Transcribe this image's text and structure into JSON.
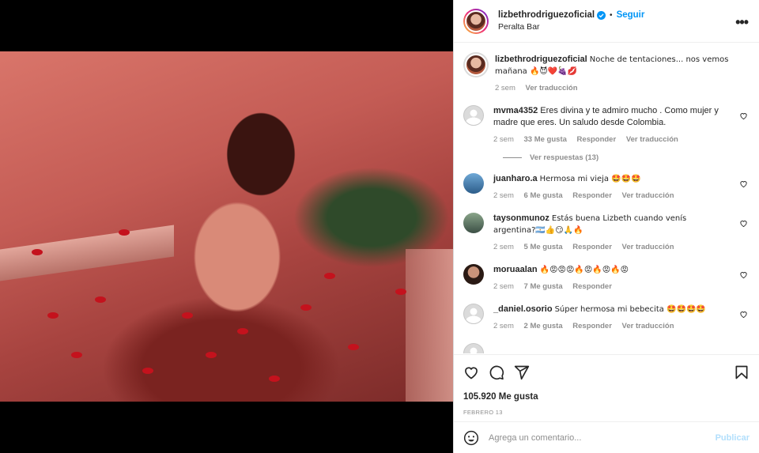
{
  "post": {
    "username": "lizbethrodriguezoficial",
    "follow_label": "Seguir",
    "location": "Peralta Bar",
    "more_label": "•••",
    "caption_user": "lizbethrodriguezoficial",
    "caption_text": "Noche de tentaciones... nos vemos mañana 🔥😈❤️🍇💋",
    "caption_time": "2 sem",
    "caption_translate": "Ver traducción",
    "likes": "105.920 Me gusta",
    "date": "FEBRERO 13"
  },
  "comments": [
    {
      "user": "mvma4352",
      "text": "Eres divina y te admiro mucho . Como mujer y madre que eres. Un saludo desde Colombia.",
      "time": "2 sem",
      "likes": "33 Me gusta",
      "reply": "Responder",
      "translate": "Ver traducción",
      "replies_label": "Ver respuestas (13)"
    },
    {
      "user": "juanharo.a",
      "text": "Hermosa mi vieja 🤩🤩🤩",
      "time": "2 sem",
      "likes": "6 Me gusta",
      "reply": "Responder",
      "translate": "Ver traducción"
    },
    {
      "user": "taysonmunoz",
      "text": "Estás buena Lizbeth cuando venís argentina?🇦🇷👍😏🙏🔥",
      "time": "2 sem",
      "likes": "5 Me gusta",
      "reply": "Responder",
      "translate": "Ver traducción"
    },
    {
      "user": "moruaalan",
      "text": "🔥😡😡😡🔥😡🔥😡🔥😡",
      "time": "2 sem",
      "likes": "7 Me gusta",
      "reply": "Responder",
      "translate": ""
    },
    {
      "user": "_daniel.osorio",
      "text": "Súper hermosa mi bebecita 🤩🤩🤩🤩",
      "time": "2 sem",
      "likes": "2 Me gusta",
      "reply": "Responder",
      "translate": "Ver traducción"
    }
  ],
  "add_comment": {
    "placeholder": "Agrega un comentario...",
    "post_label": "Publicar"
  },
  "colors": {
    "link": "#0095f6",
    "muted": "#8e8e8e",
    "post_disabled": "#b2dffc"
  },
  "icons": [
    "verified-icon",
    "more-icon",
    "heart-icon",
    "comment-icon",
    "share-icon",
    "bookmark-icon",
    "emoji-icon"
  ]
}
